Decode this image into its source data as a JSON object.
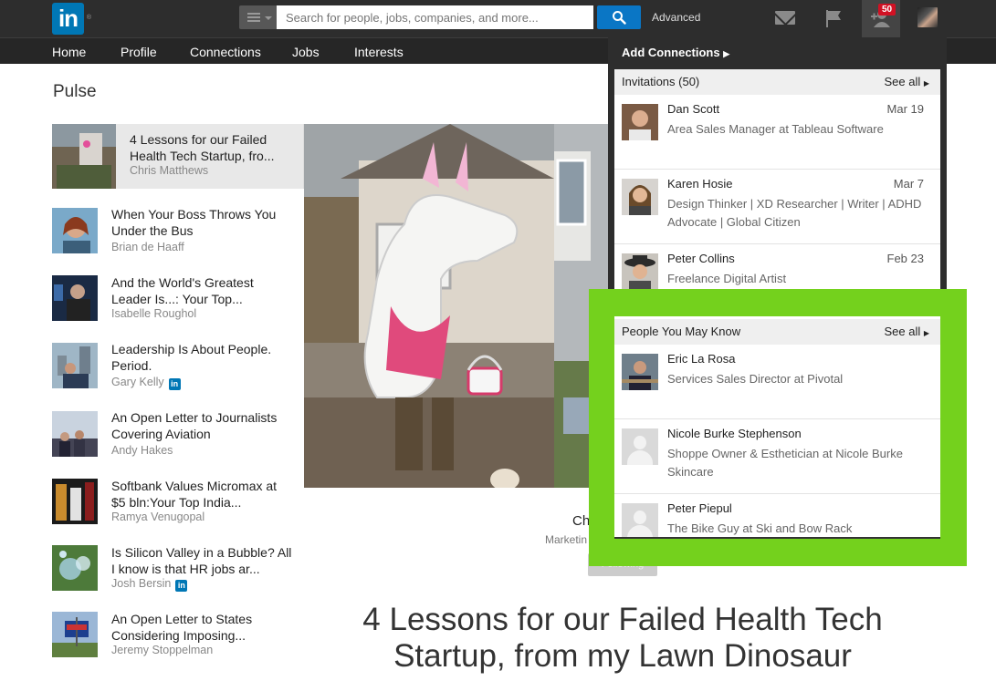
{
  "topbar": {
    "logo_text": "in",
    "search_placeholder": "Search for people, jobs, companies, and more...",
    "advanced_label": "Advanced",
    "badge_count": "50"
  },
  "nav": {
    "items": [
      "Home",
      "Profile",
      "Connections",
      "Jobs",
      "Interests"
    ]
  },
  "page_title": "Pulse",
  "feed": {
    "featured": {
      "title": "4 Lessons for our Failed Health Tech Startup, fro...",
      "author": "Chris Matthews"
    },
    "items": [
      {
        "title": "When Your Boss Throws You Under the Bus",
        "author": "Brian de Haaff",
        "influencer": false
      },
      {
        "title": "And the World's Greatest Leader Is...: Your Top...",
        "author": "Isabelle Roughol",
        "influencer": false
      },
      {
        "title": "Leadership Is About People. Period.",
        "author": "Gary Kelly",
        "influencer": true
      },
      {
        "title": "An Open Letter to Journalists Covering Aviation",
        "author": "Andy Hakes",
        "influencer": false
      },
      {
        "title": "Softbank Values Micromax at $5 bln:Your Top India...",
        "author": "Ramya Venugopal",
        "influencer": false
      },
      {
        "title": "Is Silicon Valley in a Bubble? All I know is that HR jobs ar...",
        "author": "Josh Bersin",
        "influencer": true
      },
      {
        "title": "An Open Letter to States Considering Imposing...",
        "author": "Jeremy Stoppelman",
        "influencer": false
      }
    ]
  },
  "article": {
    "headline": "4 Lessons for our Failed Health Tech Startup, from my Lawn Dinosaur",
    "author_partial": "Ch",
    "role_partial": "Marketin",
    "follow_label": "Following"
  },
  "dropdown": {
    "header": "Add Connections",
    "invitations": {
      "label": "Invitations (50)",
      "see_all": "See all",
      "rows": [
        {
          "name": "Dan Scott",
          "date": "Mar 19",
          "headline": "Area Sales Manager at Tableau Software"
        },
        {
          "name": "Karen Hosie",
          "date": "Mar 7",
          "headline": "Design Thinker | XD Researcher | Writer | ADHD Advocate | Global Citizen"
        },
        {
          "name": "Peter Collins",
          "date": "Feb 23",
          "headline": "Freelance Digital Artist"
        }
      ]
    },
    "pymk": {
      "label": "People You May Know",
      "see_all": "See all",
      "rows": [
        {
          "name": "Eric La Rosa",
          "headline": "Services Sales Director at Pivotal"
        },
        {
          "name": "Nicole Burke Stephenson",
          "headline": "Shoppe Owner & Esthetician at Nicole Burke Skincare"
        },
        {
          "name": "Peter Piepul",
          "headline": "The Bike Guy at Ski and Bow Rack"
        }
      ]
    }
  },
  "colors": {
    "linkedin_blue": "#0077b5",
    "highlight_green": "#74d11d",
    "topbar": "#2d2d2d",
    "badge_red": "#d11124"
  }
}
